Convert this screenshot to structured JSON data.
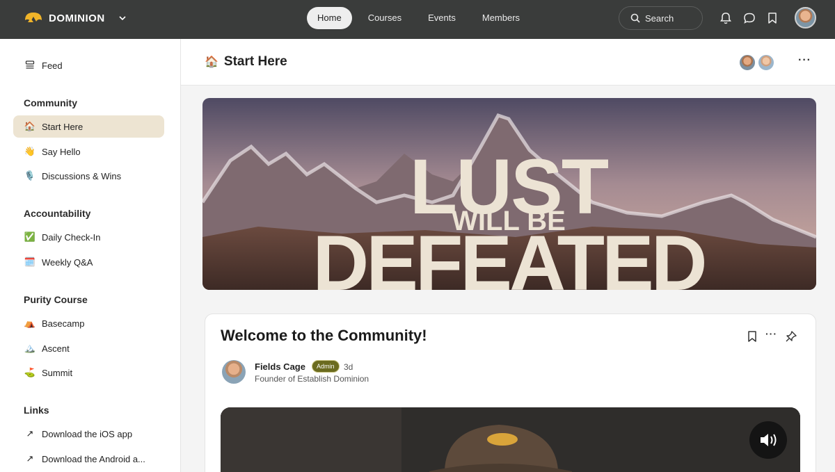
{
  "topbar": {
    "brand": "DOMINION",
    "nav": [
      {
        "label": "Home",
        "active": true
      },
      {
        "label": "Courses",
        "active": false
      },
      {
        "label": "Events",
        "active": false
      },
      {
        "label": "Members",
        "active": false
      }
    ],
    "search_label": "Search",
    "icons": [
      "bell-icon",
      "chat-icon",
      "bookmark-icon"
    ]
  },
  "sidebar": {
    "feed": {
      "label": "Feed",
      "icon": "feed-icon"
    },
    "sections": [
      {
        "title": "Community",
        "items": [
          {
            "label": "Start Here",
            "icon": "🏠",
            "active": true
          },
          {
            "label": "Say Hello",
            "icon": "👋"
          },
          {
            "label": "Discussions & Wins",
            "icon": "🎙️"
          }
        ]
      },
      {
        "title": "Accountability",
        "items": [
          {
            "label": "Daily Check-In",
            "icon": "✅"
          },
          {
            "label": "Weekly Q&A",
            "icon": "🗓️"
          }
        ]
      },
      {
        "title": "Purity Course",
        "items": [
          {
            "label": "Basecamp",
            "icon": "⛺"
          },
          {
            "label": "Ascent",
            "icon": "🏔️"
          },
          {
            "label": "Summit",
            "icon": "⛳"
          }
        ]
      },
      {
        "title": "Links",
        "items": [
          {
            "label": "Download the iOS app",
            "icon": "↗"
          },
          {
            "label": "Download the Android a...",
            "icon": "↗"
          }
        ]
      }
    ]
  },
  "main": {
    "page_title": "Start Here",
    "page_icon": "🏠",
    "banner": {
      "line1": "LUST",
      "line2": "WILL BE",
      "line3": "DEFEATED"
    },
    "post": {
      "title": "Welcome to the Community!",
      "author": "Fields Cage",
      "badge": "Admin",
      "age": "3d",
      "role": "Founder of Establish Dominion"
    }
  },
  "colors": {
    "topbar": "#3a3c3b",
    "active_item": "#ede4d2",
    "badge": "#6b6b1f",
    "brand_logo": "#f0b429"
  }
}
